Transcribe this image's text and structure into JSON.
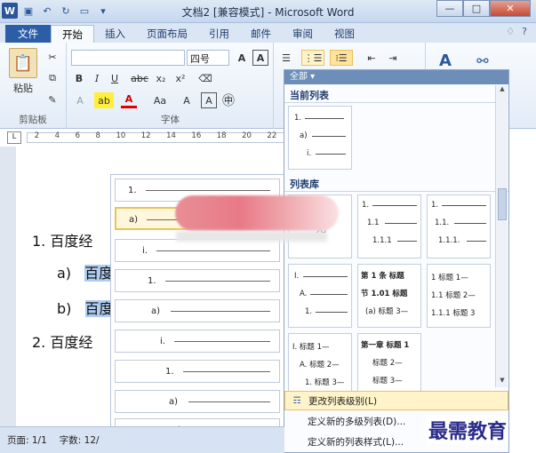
{
  "window": {
    "title": "文档2 [兼容模式] - Microsoft Word",
    "app_letter": "W",
    "min_label": "—",
    "max_label": "□",
    "close_label": "✕"
  },
  "tabs": [
    "文件",
    "开始",
    "插入",
    "页面布局",
    "引用",
    "邮件",
    "审阅",
    "视图"
  ],
  "ribbon": {
    "paste_label": "粘贴",
    "clipboard_group": "剪贴板",
    "font_group": "字体",
    "font_size": "四号",
    "bold": "B",
    "italic": "I",
    "underline": "U",
    "strike": "abc",
    "sub": "x₂",
    "sup": "x²",
    "aa": "Aa",
    "font_a": "A",
    "grow": "A",
    "circle": "㊥"
  },
  "document": {
    "line1_num": "1.",
    "line1_text": "百度经",
    "line2_num": "a)",
    "line2_text": "百度",
    "line3_num": "b)",
    "line3_text": "百度",
    "line4_num": "2.",
    "line4_text": "百度经"
  },
  "ruler_numbers": [
    "2",
    "4",
    "6",
    "8",
    "10",
    "12",
    "14",
    "16",
    "18",
    "20",
    "22"
  ],
  "left_library": [
    {
      "label": "1.",
      "offset": 14
    },
    {
      "label": "a)",
      "offset": 14
    },
    {
      "label": "i.",
      "offset": 30
    },
    {
      "label": "1.",
      "offset": 36
    },
    {
      "label": "a)",
      "offset": 40
    },
    {
      "label": "i.",
      "offset": 50
    },
    {
      "label": "1.",
      "offset": 56
    },
    {
      "label": "a)",
      "offset": 60
    },
    {
      "label": "i.",
      "offset": 70
    }
  ],
  "panel": {
    "filter_label": "全部 ▾",
    "current_list_title": "当前列表",
    "library_title": "列表库",
    "current_tile": {
      "lines": [
        "1.",
        "a)",
        "i."
      ]
    },
    "tiles": [
      {
        "lines": [
          "无"
        ]
      },
      {
        "lines": [
          "1.",
          "1.1",
          "1.1.1"
        ]
      },
      {
        "lines": [
          "1.",
          "1.1.",
          "1.1.1."
        ]
      },
      {
        "lines": [
          "I.",
          "A.",
          "1."
        ]
      },
      {
        "lines": [
          "第 1 条 标题",
          "节 1.01 标题",
          "(a) 标题 3—"
        ]
      },
      {
        "lines": [
          "1 标题 1—",
          "1.1 标题 2—",
          "1.1.1 标题 3"
        ]
      },
      {
        "lines": [
          "I. 标题 1—",
          "A. 标题 2—",
          "1. 标题 3—"
        ]
      },
      {
        "lines": [
          "第一章 标题 1",
          "标题 2—",
          "标题 3—"
        ]
      }
    ],
    "menu": [
      "更改列表级别(L)",
      "定义新的多级列表(D)...",
      "定义新的列表样式(L)..."
    ]
  },
  "status": {
    "page": "页面: 1/1",
    "words": "字数: 12/"
  },
  "watermark": "最需教育"
}
